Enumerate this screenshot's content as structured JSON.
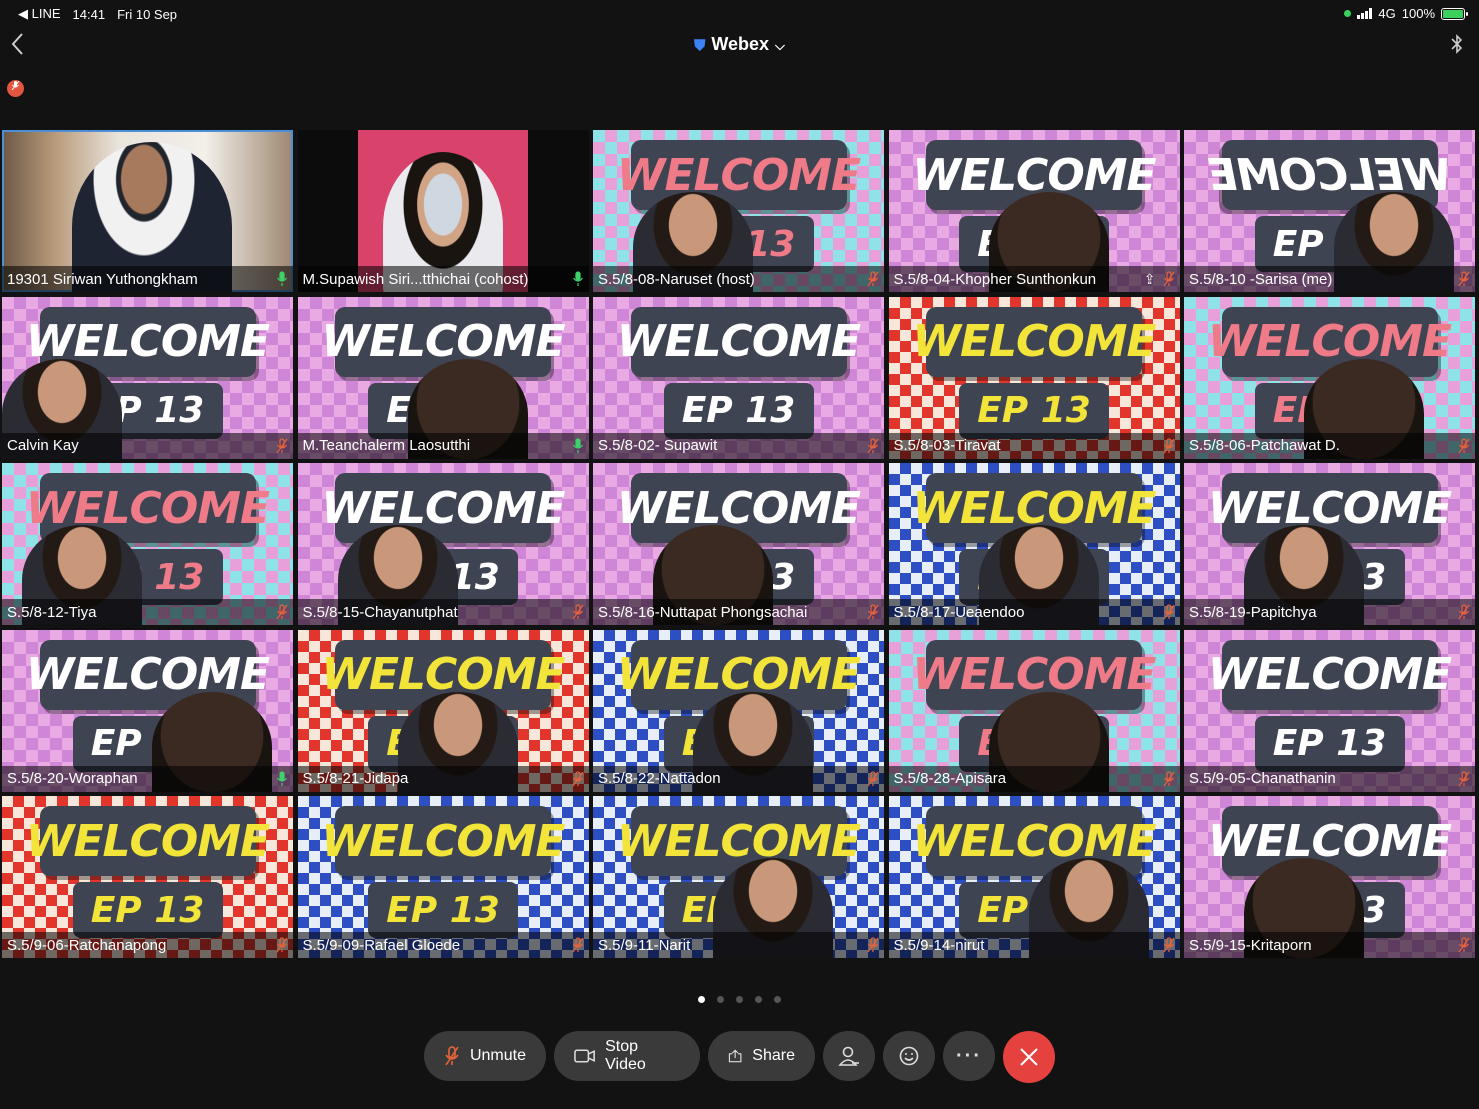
{
  "status_bar": {
    "carrier": "◀ LINE",
    "time": "14:41",
    "date": "Fri 10 Sep",
    "network": "4G",
    "battery": "100%"
  },
  "header": {
    "title": "Webex",
    "back_icon": "chevron-left-icon",
    "bluetooth_icon": "bluetooth-icon"
  },
  "banner": {
    "welcome": "WELCOME",
    "welcome_mirrored": "WELCOME",
    "episode": "EP 13"
  },
  "participants": [
    {
      "name": "19301 Siriwan Yuthongkham",
      "mic": "on",
      "bg": "room"
    },
    {
      "name": "M.Supawish Siri...tthichai (cohost)",
      "mic": "on",
      "bg": "dark"
    },
    {
      "name": "S.5/8-08-Naruset (host)",
      "mic": "muted",
      "bg": "cyan"
    },
    {
      "name": "S.5/8-04-Khopher Sunthonkun",
      "mic": "muted",
      "bg": "pink",
      "sharing": true
    },
    {
      "name": "S.5/8-10 -Sarisa (me)",
      "mic": "muted",
      "bg": "pink",
      "mirrored": true
    },
    {
      "name": "Calvin Kay",
      "mic": "muted",
      "bg": "pink"
    },
    {
      "name": "M.Teanchalerm Laosutthi",
      "mic": "on",
      "bg": "pink"
    },
    {
      "name": "S.5/8-02- Supawit",
      "mic": "muted",
      "bg": "pink"
    },
    {
      "name": "S.5/8-03-Tiravat",
      "mic": "muted",
      "bg": "red"
    },
    {
      "name": "S.5/8-06-Patchawat D.",
      "mic": "muted",
      "bg": "cyan"
    },
    {
      "name": "S.5/8-12-Tiya",
      "mic": "muted",
      "bg": "cyan"
    },
    {
      "name": "S.5/8-15-Chayanutphat",
      "mic": "muted",
      "bg": "pink"
    },
    {
      "name": "S.5/8-16-Nuttapat Phongsachai",
      "mic": "muted",
      "bg": "pink"
    },
    {
      "name": "S.5/8-17-Ueaendoo",
      "mic": "muted",
      "bg": "blue"
    },
    {
      "name": "S.5/8-19-Papitchya",
      "mic": "muted",
      "bg": "pink"
    },
    {
      "name": "S.5/8-20-Woraphan",
      "mic": "on",
      "bg": "pink"
    },
    {
      "name": "S.5/8-21-Jidapa",
      "mic": "muted",
      "bg": "red"
    },
    {
      "name": "S.5/8-22-Nattadon",
      "mic": "muted",
      "bg": "blue"
    },
    {
      "name": "S.5/8-28-Apisara",
      "mic": "muted",
      "bg": "cyan"
    },
    {
      "name": "S.5/9-05-Chanathanin",
      "mic": "muted",
      "bg": "pink"
    },
    {
      "name": "S.5/9-06-Ratchanapong",
      "mic": "muted",
      "bg": "red"
    },
    {
      "name": "S.5/9-09-Rafael Gloede",
      "mic": "muted",
      "bg": "blue"
    },
    {
      "name": "S.5/9-11-Narit",
      "mic": "muted",
      "bg": "blue"
    },
    {
      "name": "S.5/9-14-nirut",
      "mic": "muted",
      "bg": "blue"
    },
    {
      "name": "S.5/9-15-Kritaporn",
      "mic": "muted",
      "bg": "pink"
    }
  ],
  "pagination": {
    "pages": 5,
    "current": 1
  },
  "controls": {
    "unmute": "Unmute",
    "stop_video": "Stop Video",
    "share": "Share"
  },
  "colors": {
    "mic_on": "#3fd16a",
    "mic_muted": "#e8633a",
    "end_call": "#e5413f",
    "active_border": "#4b8fd6"
  }
}
